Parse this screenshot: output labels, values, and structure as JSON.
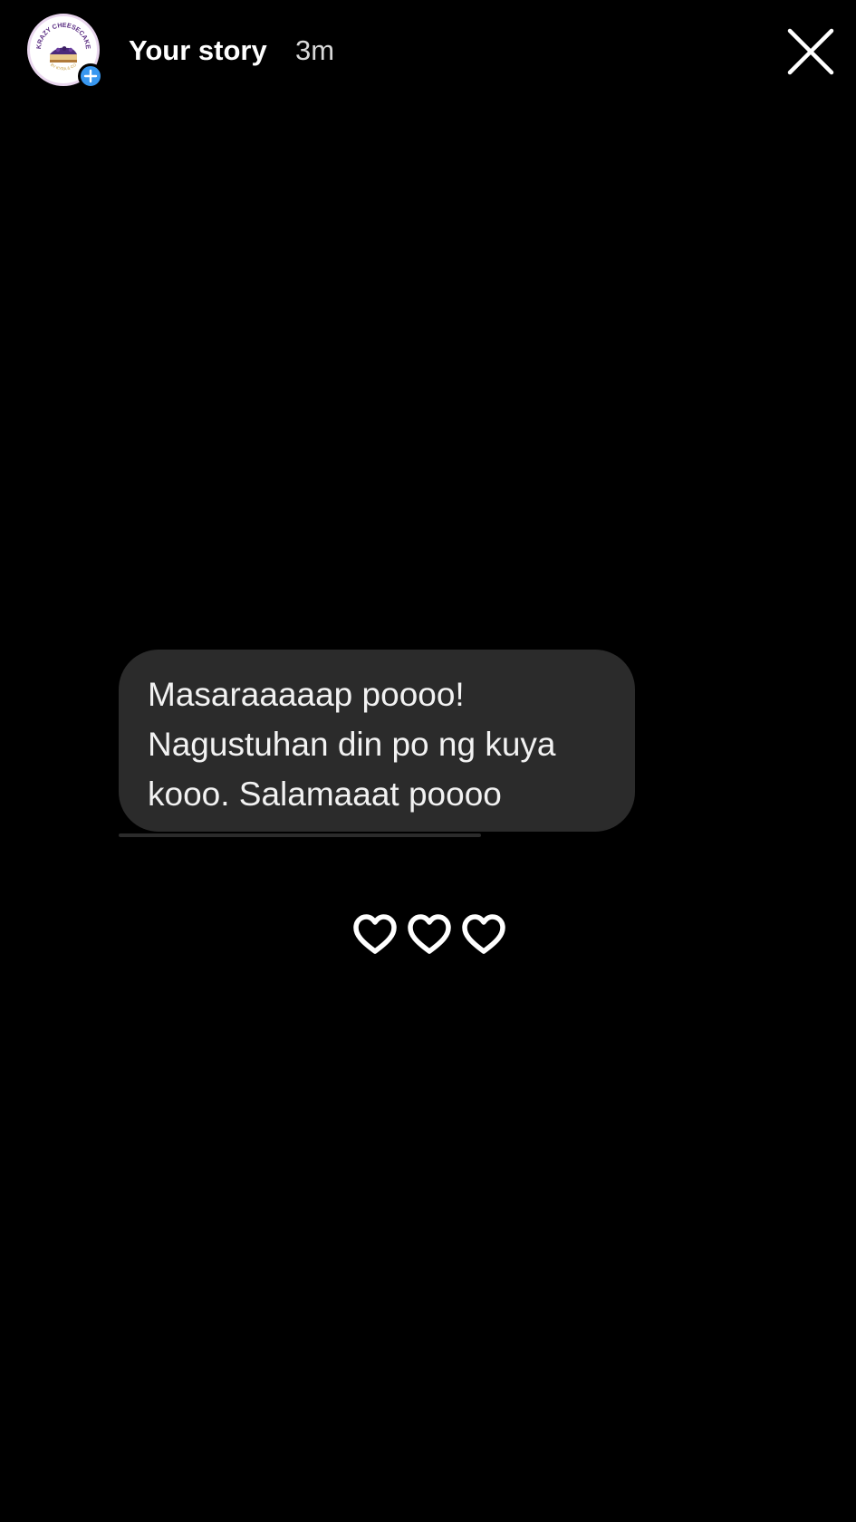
{
  "header": {
    "title": "Your story",
    "time": "3m",
    "avatar": {
      "brand_top": "KRAZY CHEESECAKE",
      "brand_bottom": "BY KYRA & CO"
    }
  },
  "message": {
    "lines": [
      "Masaraaaaap poooo!",
      "Nagustuhan din po ng kuya",
      "kooo. Salamaaat poooo"
    ]
  },
  "reactions": {
    "icons": [
      "heart-icon",
      "heart-icon",
      "heart-icon"
    ]
  },
  "colors": {
    "background": "#000000",
    "bubble": "#2b2b2b",
    "badge": "#3897f0",
    "brand_purple": "#5a2d82"
  }
}
